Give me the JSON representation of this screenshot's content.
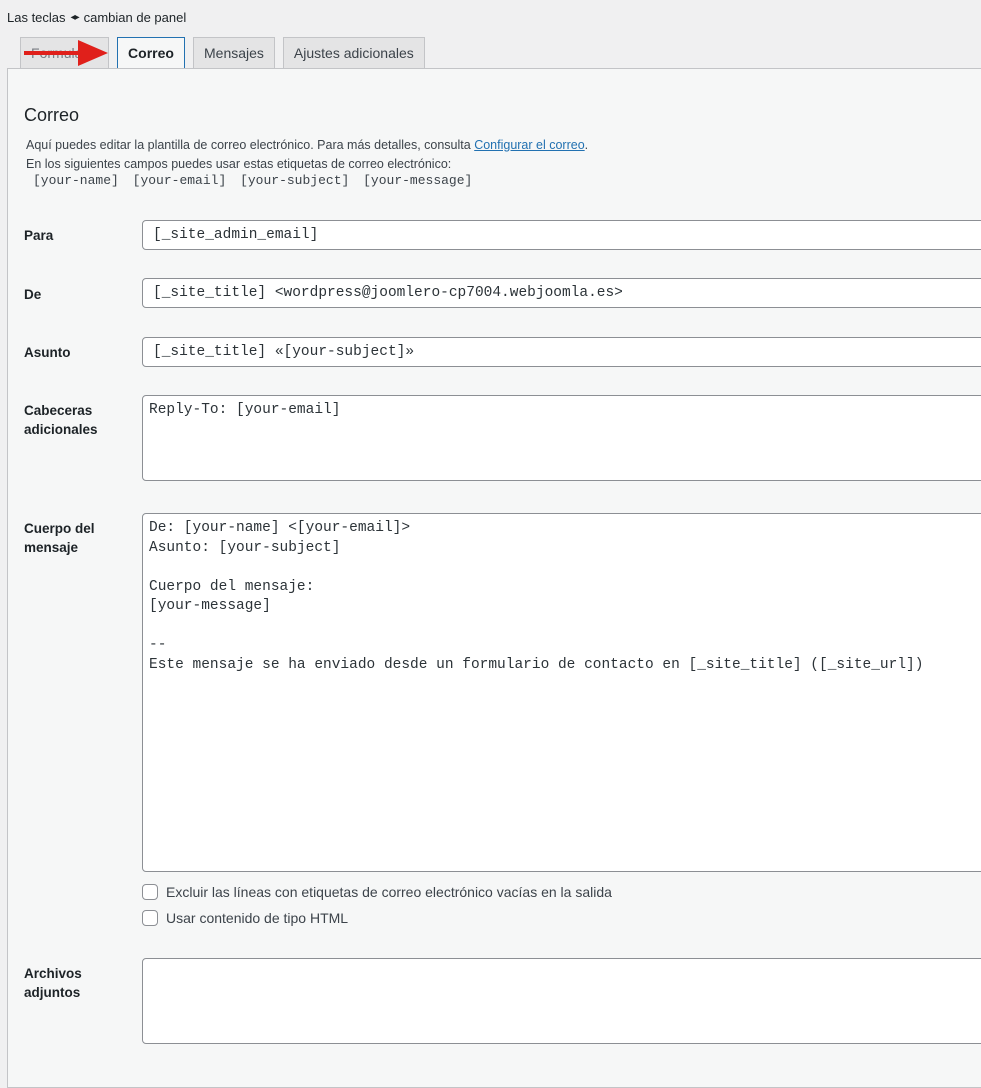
{
  "hint": {
    "prefix": "Las teclas",
    "arrows": "◂▸",
    "suffix": "cambian de panel"
  },
  "tabs": [
    {
      "label": "Formulario"
    },
    {
      "label": "Correo"
    },
    {
      "label": "Mensajes"
    },
    {
      "label": "Ajustes adicionales"
    }
  ],
  "panel": {
    "title": "Correo",
    "desc_line1_prefix": "Aquí puedes editar la plantilla de correo electrónico. Para más detalles, consulta ",
    "desc_link": "Configurar el correo",
    "desc_line1_suffix": ".",
    "desc_line2": "En los siguientes campos puedes usar estas etiquetas de correo electrónico:",
    "tags": [
      "[your-name]",
      "[your-email]",
      "[your-subject]",
      "[your-message]"
    ]
  },
  "fields": {
    "to_label": "Para",
    "to_value": "[_site_admin_email]",
    "from_label": "De",
    "from_value": "[_site_title] <wordpress@joomlero-cp7004.webjoomla.es>",
    "subject_label": "Asunto",
    "subject_value": "[_site_title] «[your-subject]»",
    "headers_label": "Cabeceras adicionales",
    "headers_value": "Reply-To: [your-email]",
    "body_label": "Cuerpo del mensaje",
    "body_value": "De: [your-name] <[your-email]>\nAsunto: [your-subject]\n\nCuerpo del mensaje:\n[your-message]\n\n--\nEste mensaje se ha enviado desde un formulario de contacto en [_site_title] ([_site_url])",
    "exclude_blank_label": "Excluir las líneas con etiquetas de correo electrónico vacías en la salida",
    "html_label": "Usar contenido de tipo HTML",
    "attachments_label": "Archivos adjuntos",
    "attachments_value": ""
  },
  "colors": {
    "accent": "#2271b1",
    "arrow": "#e0201b"
  }
}
